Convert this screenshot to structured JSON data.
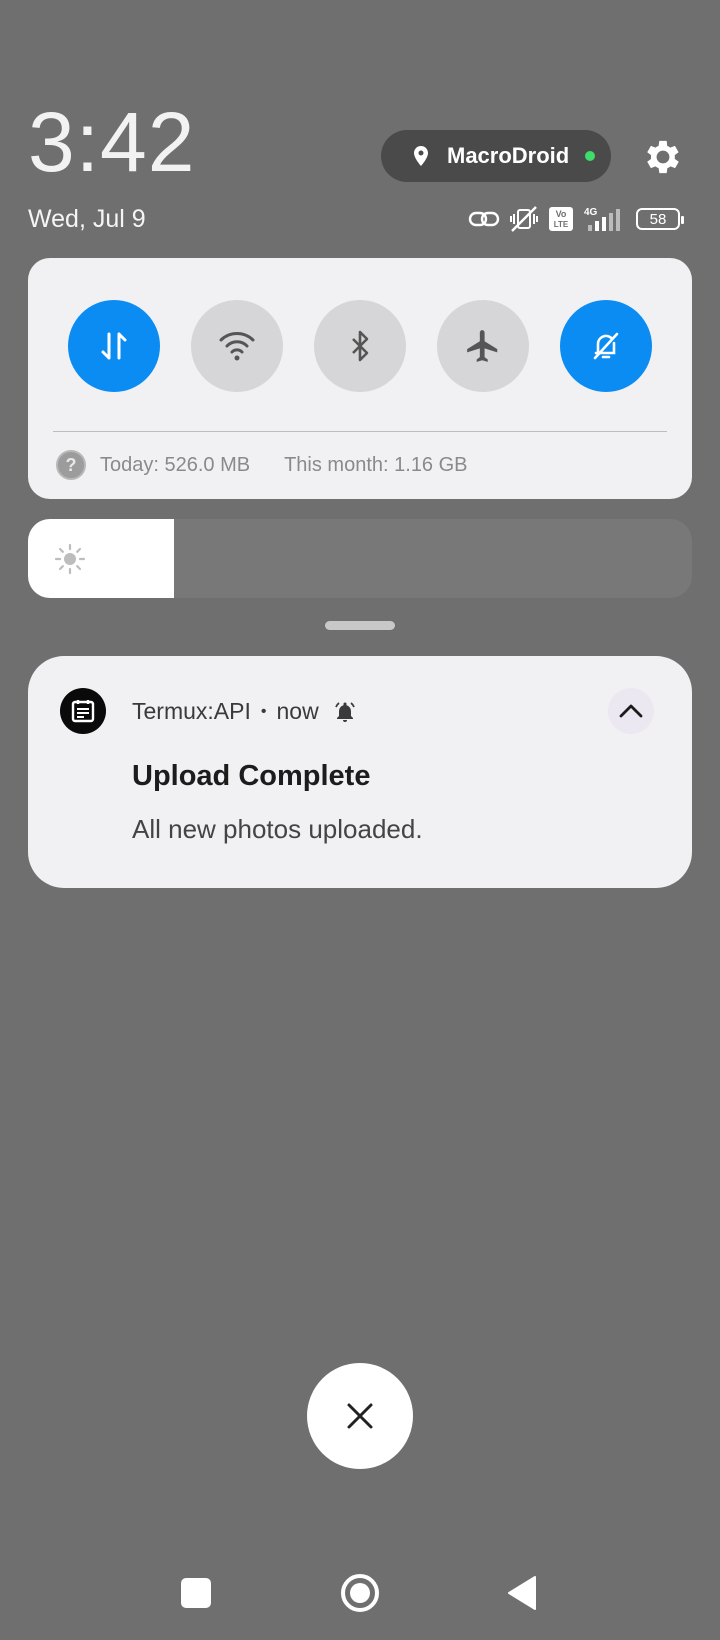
{
  "header": {
    "time": "3:42",
    "date": "Wed, Jul 9",
    "location_chip": {
      "label": "MacroDroid",
      "icon": "location-pin-icon",
      "status_color": "#3ddc6b"
    },
    "settings_icon": "gear-icon"
  },
  "status_bar": {
    "icons": [
      "link-icon",
      "vibrate-off-icon",
      "volte-icon",
      "4g-signal-icon"
    ],
    "network": "4G",
    "volte": "Vo LTE",
    "battery": "58"
  },
  "quick_settings": {
    "toggles": [
      {
        "name": "mobile-data",
        "icon": "data-transfer-icon",
        "state": "on"
      },
      {
        "name": "wifi",
        "icon": "wifi-icon",
        "state": "off"
      },
      {
        "name": "bluetooth",
        "icon": "bluetooth-icon",
        "state": "off"
      },
      {
        "name": "airplane-mode",
        "icon": "airplane-icon",
        "state": "off"
      },
      {
        "name": "do-not-disturb",
        "icon": "bell-off-icon",
        "state": "on"
      }
    ],
    "accent_color": "#0b8cf2",
    "usage": {
      "help_icon": "?",
      "today": "Today: 526.0 MB",
      "month": "This month: 1.16 GB"
    }
  },
  "brightness": {
    "level": 0.22,
    "icon": "sun-icon"
  },
  "notification": {
    "app": "Termux:API",
    "separator": "•",
    "time": "now",
    "title": "Upload Complete",
    "body": "All new photos uploaded.",
    "app_icon": "calendar-note-icon",
    "alert_icon": "bell-icon",
    "collapse_icon": "chevron-up-icon"
  },
  "dismiss_icon": "close-icon",
  "navigation": {
    "recent_icon": "square-icon",
    "home_icon": "circle-icon",
    "back_icon": "triangle-back-icon"
  }
}
